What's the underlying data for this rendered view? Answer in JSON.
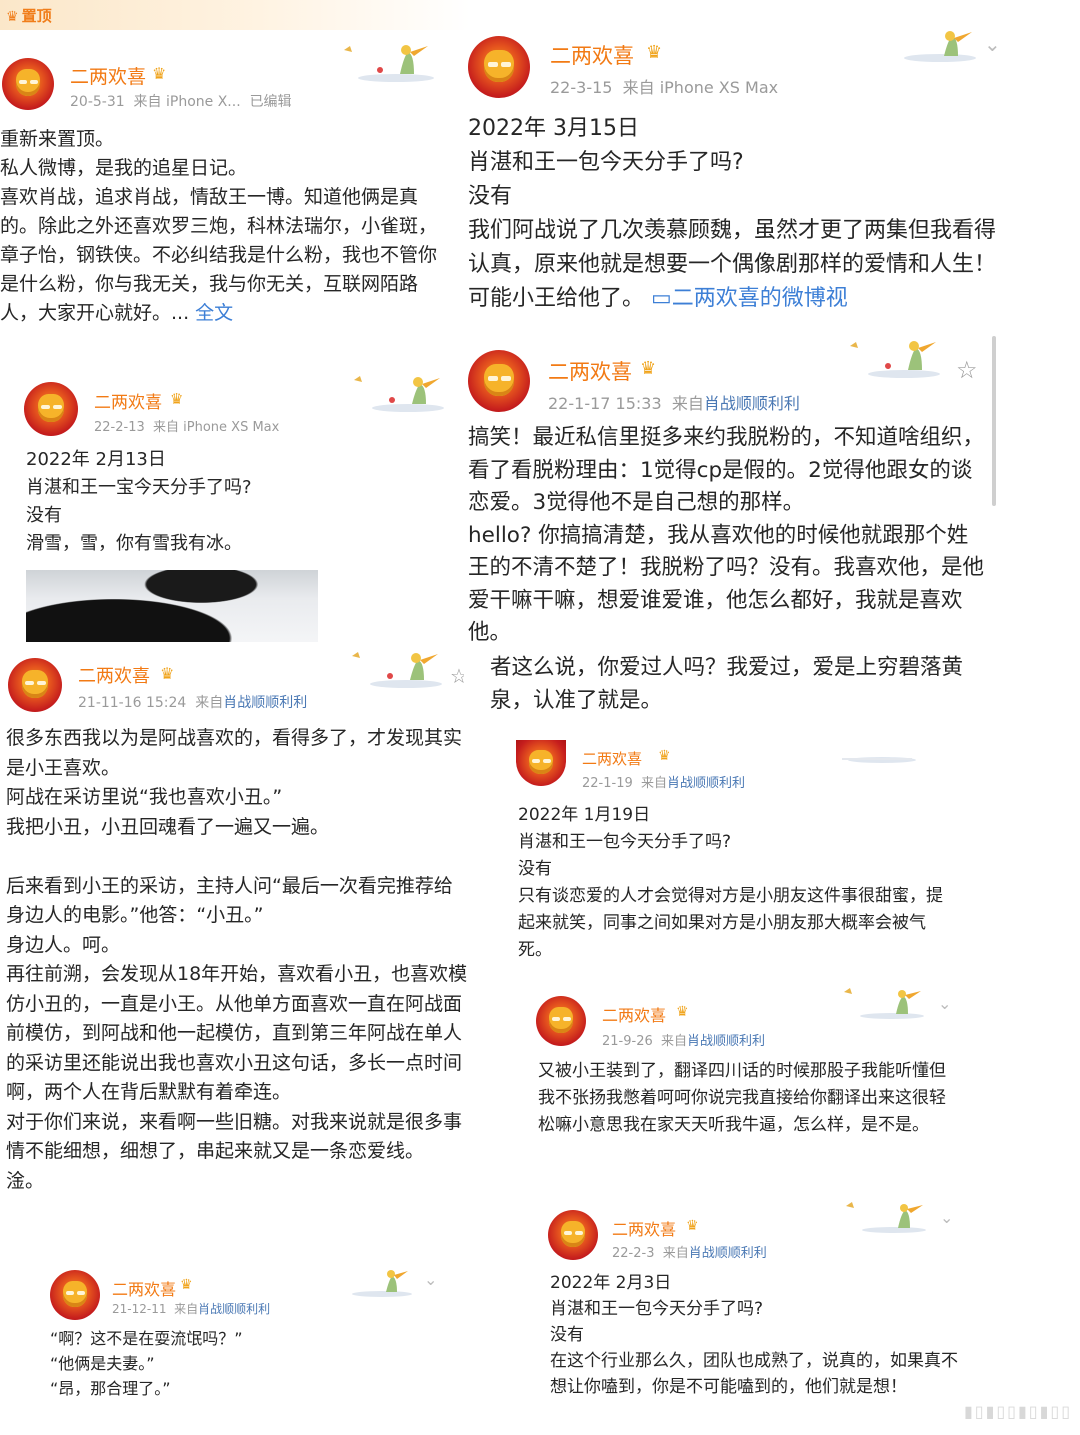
{
  "pinned_label": "置顶",
  "posts": [
    {
      "user": "二两欢喜",
      "date": "20-5-31",
      "source": "来自 iPhone X...",
      "edited": "已编辑",
      "body": "重新来置顶。\n私人微博，是我的追星日记。\n喜欢肖战，追求肖战，情敌王一博。知道他俩是真的。除此之外还喜欢罗三炮，科林法瑞尔，小雀斑，章子怡，钢铁侠。不必纠结我是什么粉，我也不管你是什么粉，你与我无关，我与你无关，互联网陌路人，大家开心就好。...",
      "more": "全文"
    },
    {
      "user": "二两欢喜",
      "date": "22-2-13",
      "source": "来自 iPhone XS Max",
      "body": "2022年 2月13日\n肖湛和王一宝今天分手了吗?\n没有\n滑雪，雪，你有雪我有冰。"
    },
    {
      "user": "二两欢喜",
      "date": "21-11-16 15:24",
      "source_prefix": "来自",
      "source": "肖战顺顺利利",
      "body": "很多东西我以为是阿战喜欢的，看得多了，才发现其实是小王喜欢。\n阿战在采访里说“我也喜欢小丑。”\n我把小丑，小丑回魂看了一遍又一遍。\n\n后来看到小王的采访，主持人问“最后一次看完推荐给身边人的电影。”他答：“小丑。”\n身边人。呵。\n再往前溯，会发现从18年开始，喜欢看小丑，也喜欢模仿小丑的，一直是小王。从他单方面喜欢一直在阿战面前模仿，到阿战和他一起模仿，直到第三年阿战在单人的采访里还能说出我也喜欢小丑这句话，多长一点时间啊，两个人在背后默默有着牵连。\n对于你们来说，来看啊一些旧糖。对我来说就是很多事情不能细想，细想了，串起来就又是一条恋爱线。\n淦。"
    },
    {
      "user": "二两欢喜",
      "date": "21-12-11",
      "source_prefix": "来自",
      "source": "肖战顺顺利利",
      "body": "“啊？这不是在耍流氓吗？”\n“他俩是夫妻。”\n“昂，那合理了。”"
    },
    {
      "user": "二两欢喜",
      "date": "22-3-15",
      "source": "来自 iPhone XS Max",
      "body": "2022年 3月15日\n肖湛和王一包今天分手了吗?\n没有\n我们阿战说了几次羡慕顾魏，虽然才更了两集但我看得认真，原来他就是想要一个偶像剧那样的爱情和人生！可能小王给他了。 ",
      "link": "▭二两欢喜的微博视"
    },
    {
      "user": "二两欢喜",
      "date": "22-1-17 15:33",
      "source_prefix": "来自",
      "source": "肖战顺顺利利",
      "body": "搞笑！最近私信里挺多来约我脱粉的，不知道啥组织，看了看脱粉理由：1觉得cp是假的。2觉得他跟女的谈恋爱。3觉得他不是自己想的那样。\nhello? 你搞搞清楚，我从喜欢他的时候他就跟那个姓王的不清不楚了！我脱粉了吗？没有。我喜欢他，是他爱干嘛干嘛，想爱谁爱谁，他怎么都好，我就是喜欢他。",
      "quote": "者这么说，你爱过人吗？我爱过，爱是上穷碧落黄泉，认准了就是。"
    },
    {
      "user": "二两欢喜",
      "date": "22-1-19",
      "source_prefix": "来自",
      "source": "肖战顺顺利利",
      "body": "2022年 1月19日\n肖湛和王一包今天分手了吗?\n没有\n只有谈恋爱的人才会觉得对方是小朋友这件事很甜蜜，提起来就笑，同事之间如果对方是小朋友那大概率会被气死。"
    },
    {
      "user": "二两欢喜",
      "date": "21-9-26",
      "source_prefix": "来自",
      "source": "肖战顺顺利利",
      "body": "又被小王装到了，翻译四川话的时候那股子我能听懂但我不张扬我憋着呵呵你说完我直接给你翻译出来这很轻松嘛小意思我在家天天听我牛逼，怎么样，是不是。"
    },
    {
      "user": "二两欢喜",
      "date": "22-2-3",
      "source_prefix": "来自",
      "source": "肖战顺顺利利",
      "body": "2022年 2月3日\n肖湛和王一包今天分手了吗?\n没有\n在这个行业那么久，团队也成熟了，说真的，如果真不想让你嗑到，你是不可能嗑到的，他们就是想！"
    }
  ]
}
